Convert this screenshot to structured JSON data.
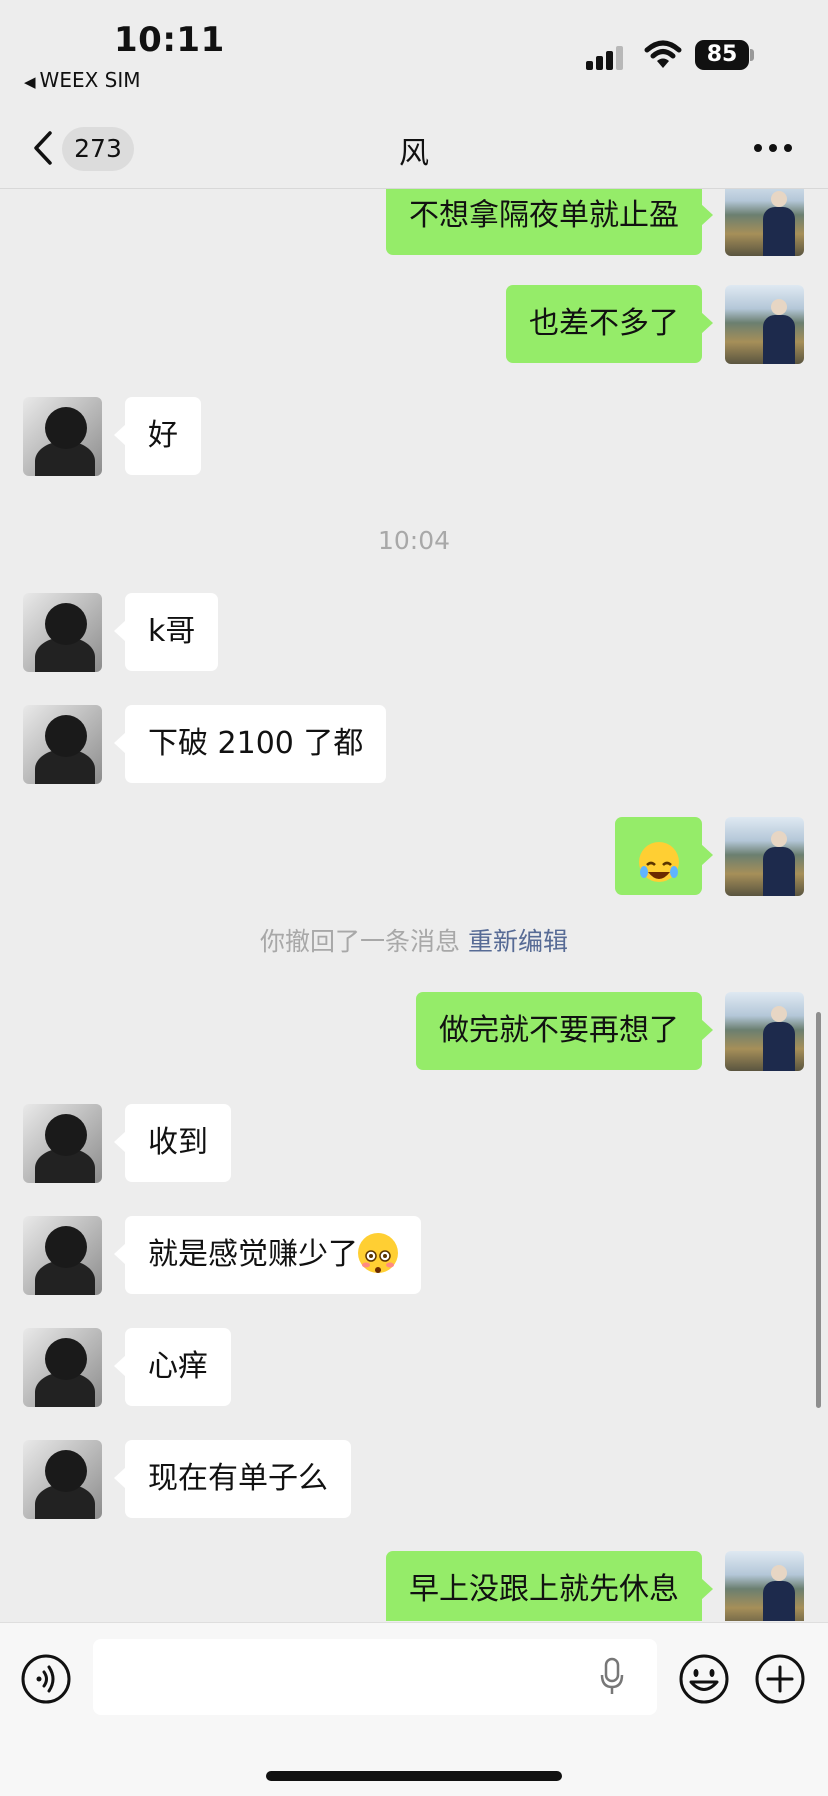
{
  "status_bar": {
    "time": "10:11",
    "carrier": "WEEX SIM",
    "battery": "85"
  },
  "nav": {
    "unread_count": "273",
    "title": "风",
    "more_icon": "more-dots-icon"
  },
  "colors": {
    "outgoing_bubble": "#95ec69",
    "incoming_bubble": "#ffffff",
    "background": "#ededed",
    "link": "#576b95"
  },
  "messages": [
    {
      "side": "out",
      "text": "不想拿隔夜单就止盈"
    },
    {
      "side": "out",
      "text": "也差不多了"
    },
    {
      "side": "in",
      "text": "好"
    },
    {
      "timestamp": "10:04"
    },
    {
      "side": "in",
      "text": "k哥"
    },
    {
      "side": "in",
      "text": "下破 2100 了都"
    },
    {
      "side": "out",
      "emoji": "tears-of-joy-emoji"
    },
    {
      "recall_text": "你撤回了一条消息",
      "recall_action": "重新编辑"
    },
    {
      "side": "out",
      "text": "做完就不要再想了"
    },
    {
      "side": "in",
      "text": "收到"
    },
    {
      "side": "in",
      "text": "就是感觉赚少了",
      "emoji": "flushed-emoji"
    },
    {
      "side": "in",
      "text": "心痒"
    },
    {
      "side": "in",
      "text": "现在有单子么"
    },
    {
      "side": "out",
      "text": "早上没跟上就先休息"
    }
  ],
  "input_bar": {
    "voice_icon": "voice-mode-icon",
    "mic_icon": "microphone-icon",
    "emoji_icon": "emoji-icon",
    "plus_icon": "plus-icon"
  }
}
